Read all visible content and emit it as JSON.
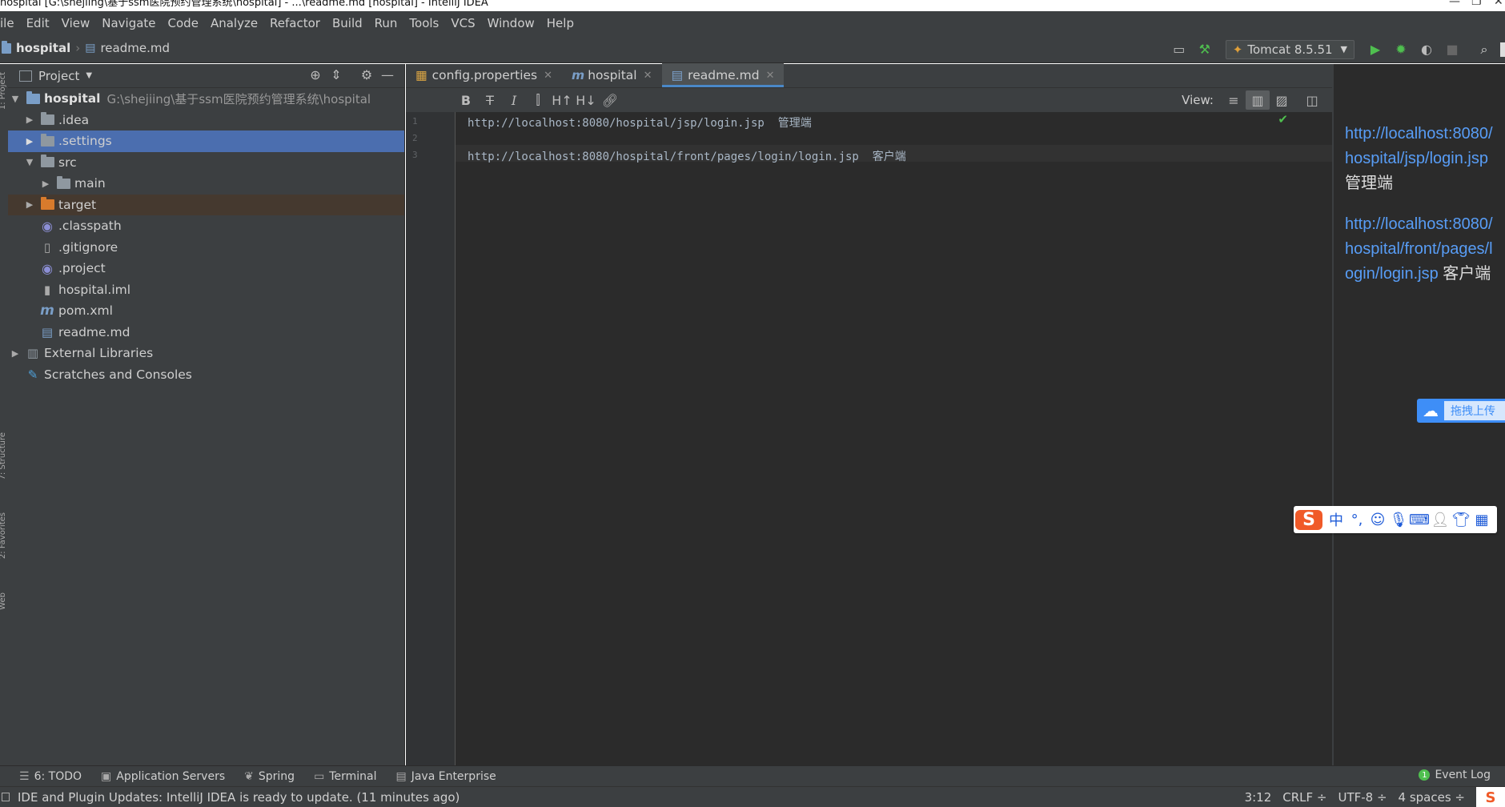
{
  "window": {
    "title": "hospital [G:\\shejiing\\基于ssm医院预约管理系统\\hospital] - ...\\readme.md [hospital] - IntelliJ IDEA"
  },
  "menu": [
    "ile",
    "Edit",
    "View",
    "Navigate",
    "Code",
    "Analyze",
    "Refactor",
    "Build",
    "Run",
    "Tools",
    "VCS",
    "Window",
    "Help"
  ],
  "breadcrumb": {
    "project": "hospital",
    "file": "readme.md"
  },
  "run_config": {
    "label": "Tomcat 8.5.51"
  },
  "project_panel": {
    "title": "Project",
    "tree": [
      {
        "label": "hospital",
        "path": "G:\\shejiing\\基于ssm医院预约管理系统\\hospital"
      },
      {
        "label": ".idea"
      },
      {
        "label": ".settings"
      },
      {
        "label": "src"
      },
      {
        "label": "main"
      },
      {
        "label": "target"
      },
      {
        "label": ".classpath"
      },
      {
        "label": ".gitignore"
      },
      {
        "label": ".project"
      },
      {
        "label": "hospital.iml"
      },
      {
        "label": "pom.xml"
      },
      {
        "label": "readme.md"
      },
      {
        "label": "External Libraries"
      },
      {
        "label": "Scratches and Consoles"
      }
    ]
  },
  "editor": {
    "tabs": [
      {
        "label": "config.properties"
      },
      {
        "label": "hospital"
      },
      {
        "label": "readme.md"
      }
    ],
    "view_label": "View:",
    "lines": [
      {
        "num": "1",
        "text": "http://localhost:8080/hospital/jsp/login.jsp  管理端"
      },
      {
        "num": "2",
        "text": ""
      },
      {
        "num": "3",
        "text": "http://localhost:8080/hospital/front/pages/login/login.jsp  客户端"
      }
    ]
  },
  "preview": {
    "para1": {
      "link": "http://localhost:8080/hospital/jsp/login.jsp",
      "text": " 管理端"
    },
    "para2": {
      "link": "http://localhost:8080/hospital/front/pages/login/login.jsp",
      "text": " 客户端"
    }
  },
  "overlay": {
    "baidu_text": "拖拽上传",
    "ime_zh": "中"
  },
  "bottom_tools": [
    "6: TODO",
    "Application Servers",
    "Spring",
    "Terminal",
    "Java Enterprise"
  ],
  "event_log": "Event Log",
  "status": {
    "message": "IDE and Plugin Updates: IntelliJ IDEA is ready to update. (11 minutes ago)",
    "position": "3:12",
    "line_sep": "CRLF ÷",
    "encoding": "UTF-8 ÷",
    "indent": "4 spaces ÷"
  },
  "colors": {
    "bg_panel": "#3c3f41",
    "bg_editor": "#2b2b2b",
    "selection": "#4b6eaf",
    "link": "#589df6",
    "run_green": "#4fbf4f"
  }
}
